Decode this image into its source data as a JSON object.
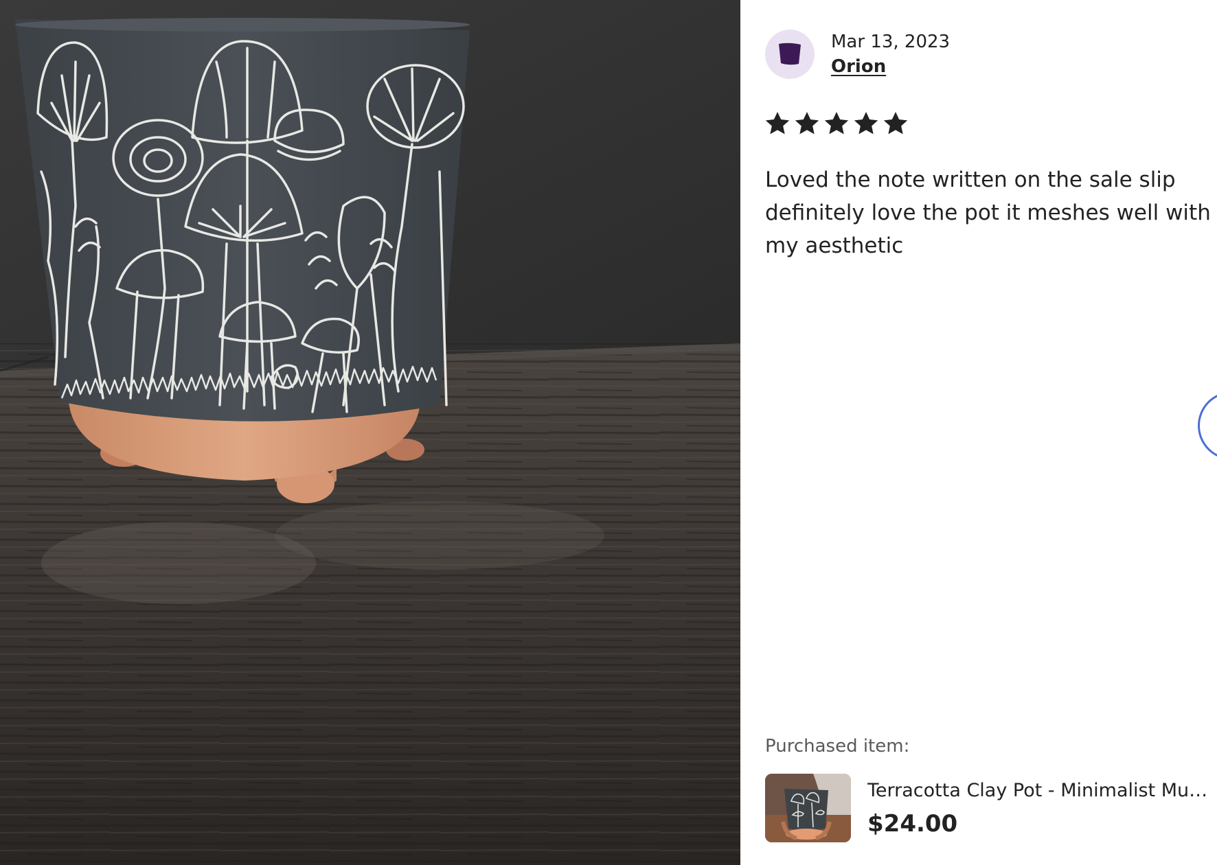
{
  "photo": {
    "icon": "review-photo-image",
    "description_icon": "mushroom-pot-photo"
  },
  "reviewer": {
    "date": "Mar 13, 2023",
    "name": "Orion",
    "avatar_icon": "reviewer-avatar-icon",
    "avatar_bg": "#e9e1f1",
    "avatar_color": "#3d1a55"
  },
  "rating": {
    "value": 5,
    "max": 5,
    "star_color": "#222222"
  },
  "review": {
    "text": "Loved the note written on the sale slip definitely love the pot it meshes well with my aesthetic"
  },
  "purchase": {
    "label": "Purchased item:",
    "title": "Terracotta Clay Pot - Minimalist Mushroom Planter",
    "price": "$24.00",
    "thumb_icon": "item-thumbnail-image"
  },
  "navigation": {
    "next_icon": "next-arrow-icon",
    "accent": "#4a6ed3"
  }
}
